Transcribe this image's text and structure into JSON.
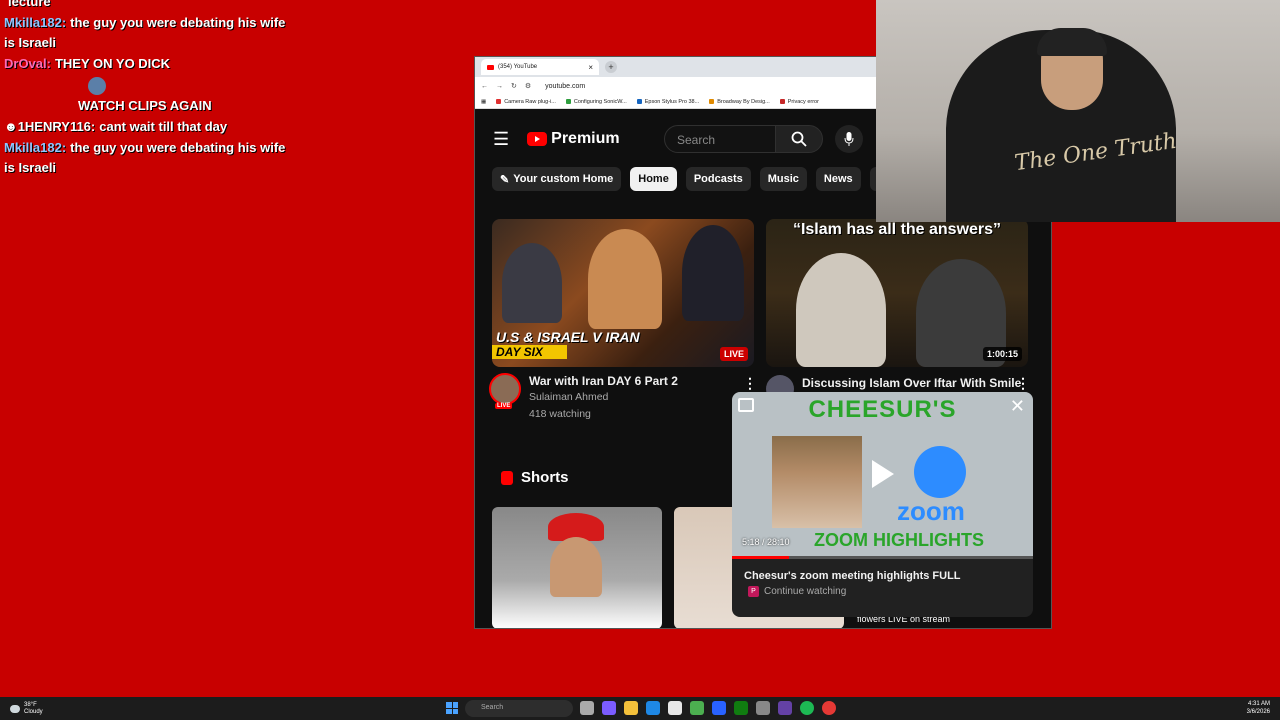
{
  "chat": [
    {
      "user": "",
      "text": "lecture",
      "user_color": "#9b59b6"
    },
    {
      "user": "Mkilla182:",
      "text": "the guy you were debating his wife is Israeli",
      "user_color": "#8ec5ff"
    },
    {
      "user": "DrOval:",
      "text": "THEY ON YO DICK",
      "user_color": "#ff69b4"
    },
    {
      "user": "",
      "text": "",
      "user_color": "#a0522d"
    },
    {
      "user": "",
      "text": "WATCH CLIPS AGAIN",
      "user_color": "#ff4d4d"
    },
    {
      "user": "1HENRY116:",
      "text": "cant wait till that day",
      "user_color": "#ffffff"
    },
    {
      "user": "Mkilla182:",
      "text": "the guy you were debating his wife is Israeli",
      "user_color": "#8ec5ff"
    }
  ],
  "browser": {
    "tab_title": "(354) YouTube",
    "url": "youtube.com",
    "bookmarks": [
      "Camera Raw plug-i...",
      "Configuring SonicW...",
      "Epson Stylus Pro 38...",
      "Broadway By Desig...",
      "Privacy error"
    ]
  },
  "youtube": {
    "logo_text": "Premium",
    "search_placeholder": "Search",
    "chips": [
      "Your custom Home",
      "Home",
      "Podcasts",
      "Music",
      "News",
      "Ga"
    ],
    "active_chip": "Home",
    "videos": [
      {
        "thumb_title": "U.S & ISRAEL V IRAN",
        "thumb_sub": "DAY SIX",
        "badge": "LIVE",
        "title": "War with Iran DAY 6 Part 2",
        "channel": "Sulaiman Ahmed",
        "meta": "418 watching",
        "avatar_badge": "LIVE"
      },
      {
        "thumb_title": "“Islam has all the answers”",
        "duration": "1:00:15",
        "title": "Discussing Islam Over Iftar With Smile"
      }
    ],
    "shorts_label": "Shorts",
    "short3_caption": "flowers LIVE on stream"
  },
  "miniplayer": {
    "brand": "CHEESUR'S",
    "zoom_word": "zoom",
    "highlights": "ZOOM HIGHLIGHTS",
    "time": "5:18 / 28:10",
    "progress": 0.19,
    "title": "Cheesur's zoom meeting highlights FULL",
    "channel_initial": "P",
    "subtitle": "Continue watching"
  },
  "webcam": {
    "shirt_text": "The One Truth"
  },
  "taskbar": {
    "temp": "38°F",
    "weather": "Cloudy",
    "search_placeholder": "Search",
    "time": "4:31 AM",
    "date": "3/6/2026"
  }
}
